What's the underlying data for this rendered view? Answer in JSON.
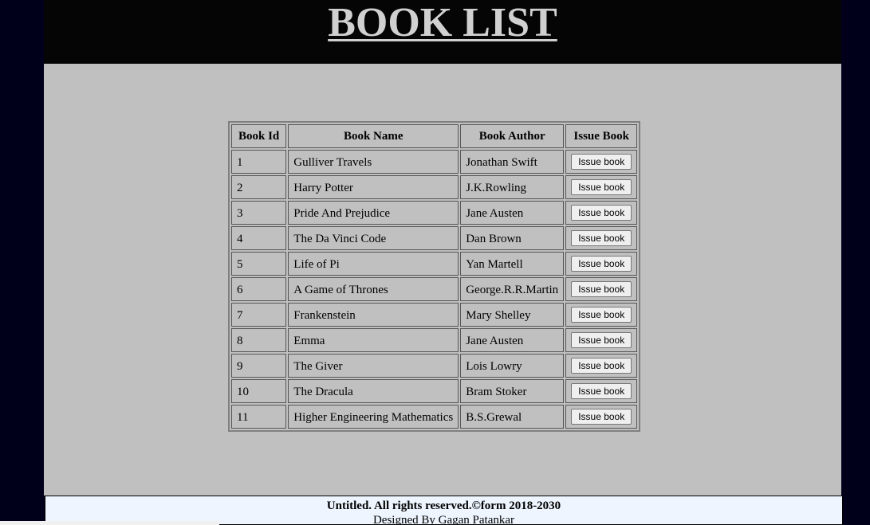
{
  "header": {
    "title": "BOOK LIST"
  },
  "table": {
    "columns": [
      "Book Id",
      "Book Name",
      "Book Author",
      "Issue Book"
    ],
    "rows": [
      {
        "id": "1",
        "name": "Gulliver Travels",
        "author": "Jonathan Swift",
        "action": "Issue book"
      },
      {
        "id": "2",
        "name": "Harry Potter",
        "author": "J.K.Rowling",
        "action": "Issue book"
      },
      {
        "id": "3",
        "name": "Pride And Prejudice",
        "author": "Jane Austen",
        "action": "Issue book"
      },
      {
        "id": "4",
        "name": "The Da Vinci Code",
        "author": "Dan Brown",
        "action": "Issue book"
      },
      {
        "id": "5",
        "name": "Life of Pi",
        "author": "Yan Martell",
        "action": "Issue book"
      },
      {
        "id": "6",
        "name": "A Game of Thrones",
        "author": "George.R.R.Martin",
        "action": "Issue book"
      },
      {
        "id": "7",
        "name": "Frankenstein",
        "author": "Mary Shelley",
        "action": "Issue book"
      },
      {
        "id": "8",
        "name": "Emma",
        "author": "Jane Austen",
        "action": "Issue book"
      },
      {
        "id": "9",
        "name": "The Giver",
        "author": "Lois Lowry",
        "action": "Issue book"
      },
      {
        "id": "10",
        "name": "The Dracula",
        "author": "Bram Stoker",
        "action": "Issue book"
      },
      {
        "id": "11",
        "name": "Higher Engineering Mathematics",
        "author": "B.S.Grewal",
        "action": "Issue book"
      }
    ]
  },
  "footer": {
    "rights": "Untitled. All rights reserved.©form 2018-2030",
    "designer": "Designed By Gagan Patankar"
  },
  "colors": {
    "page_background": "#00001a",
    "header_background": "#050505",
    "title_color": "#d0d0d0",
    "main_background": "#c0c0c0",
    "footer_background": "#eef5ff"
  }
}
